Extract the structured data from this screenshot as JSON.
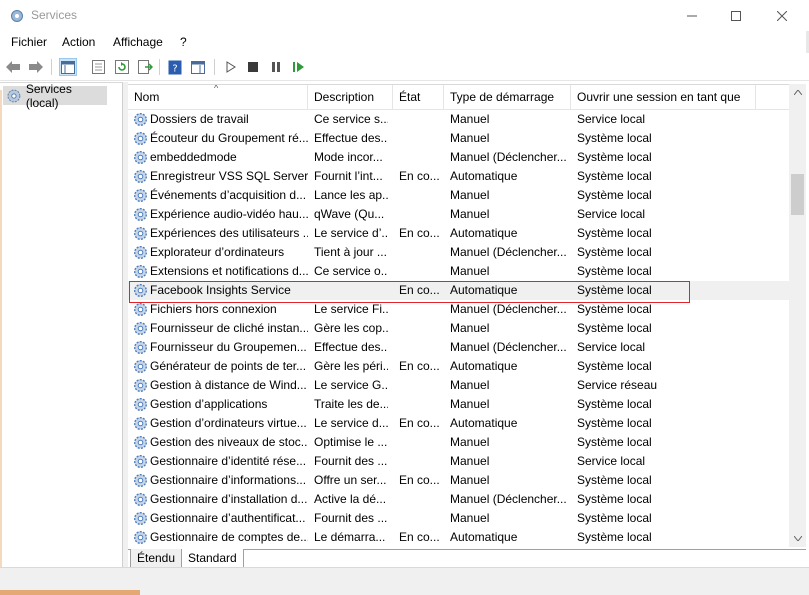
{
  "window": {
    "title": "Services"
  },
  "menu": [
    "Fichier",
    "Action",
    "Affichage",
    "?"
  ],
  "tree": {
    "root_label": "Services (local)"
  },
  "columns": [
    "Nom",
    "Description",
    "État",
    "Type de démarrage",
    "Ouvrir une session en tant que"
  ],
  "rows": [
    {
      "name": "Dossiers de travail",
      "desc": "Ce service s...",
      "state": "",
      "startup": "Manuel",
      "logon": "Service local"
    },
    {
      "name": "Écouteur du Groupement ré...",
      "desc": "Effectue des...",
      "state": "",
      "startup": "Manuel",
      "logon": "Système local"
    },
    {
      "name": "embeddedmode",
      "desc": "Mode incor...",
      "state": "",
      "startup": "Manuel (Déclencher...",
      "logon": "Système local"
    },
    {
      "name": "Enregistreur VSS SQL Server",
      "desc": "Fournit l’int...",
      "state": "En co...",
      "startup": "Automatique",
      "logon": "Système local"
    },
    {
      "name": "Événements d’acquisition d...",
      "desc": "Lance les ap...",
      "state": "",
      "startup": "Manuel",
      "logon": "Système local"
    },
    {
      "name": "Expérience audio-vidéo hau...",
      "desc": "qWave (Qu...",
      "state": "",
      "startup": "Manuel",
      "logon": "Service local"
    },
    {
      "name": "Expériences des utilisateurs ...",
      "desc": "Le service d’...",
      "state": "En co...",
      "startup": "Automatique",
      "logon": "Système local"
    },
    {
      "name": "Explorateur d’ordinateurs",
      "desc": "Tient à jour ...",
      "state": "",
      "startup": "Manuel (Déclencher...",
      "logon": "Système local"
    },
    {
      "name": "Extensions et notifications d...",
      "desc": "Ce service o...",
      "state": "",
      "startup": "Manuel",
      "logon": "Système local"
    },
    {
      "name": "Facebook Insights Service",
      "desc": "",
      "state": "En co...",
      "startup": "Automatique",
      "logon": "Système local"
    },
    {
      "name": "Fichiers hors connexion",
      "desc": "Le service Fi...",
      "state": "",
      "startup": "Manuel (Déclencher...",
      "logon": "Système local"
    },
    {
      "name": "Fournisseur de cliché instan...",
      "desc": "Gère les cop...",
      "state": "",
      "startup": "Manuel",
      "logon": "Système local"
    },
    {
      "name": "Fournisseur du Groupemen...",
      "desc": "Effectue des...",
      "state": "",
      "startup": "Manuel (Déclencher...",
      "logon": "Service local"
    },
    {
      "name": "Générateur de points de ter...",
      "desc": "Gère les péri...",
      "state": "En co...",
      "startup": "Automatique",
      "logon": "Système local"
    },
    {
      "name": "Gestion à distance de Wind...",
      "desc": "Le service G...",
      "state": "",
      "startup": "Manuel",
      "logon": "Service réseau"
    },
    {
      "name": "Gestion d’applications",
      "desc": "Traite les de...",
      "state": "",
      "startup": "Manuel",
      "logon": "Système local"
    },
    {
      "name": "Gestion d’ordinateurs virtue...",
      "desc": "Le service d...",
      "state": "En co...",
      "startup": "Automatique",
      "logon": "Système local"
    },
    {
      "name": "Gestion des niveaux de stoc...",
      "desc": "Optimise le ...",
      "state": "",
      "startup": "Manuel",
      "logon": "Système local"
    },
    {
      "name": "Gestionnaire d’identité rése...",
      "desc": "Fournit des ...",
      "state": "",
      "startup": "Manuel",
      "logon": "Service local"
    },
    {
      "name": "Gestionnaire d’informations...",
      "desc": "Offre un ser...",
      "state": "En co...",
      "startup": "Manuel",
      "logon": "Système local"
    },
    {
      "name": "Gestionnaire d’installation d...",
      "desc": "Active la dé...",
      "state": "",
      "startup": "Manuel (Déclencher...",
      "logon": "Système local"
    },
    {
      "name": "Gestionnaire d’authentificat...",
      "desc": "Fournit des ...",
      "state": "",
      "startup": "Manuel",
      "logon": "Système local"
    },
    {
      "name": "Gestionnaire de comptes de...",
      "desc": "Le démarra...",
      "state": "En co...",
      "startup": "Automatique",
      "logon": "Système local"
    }
  ],
  "selected_row": 9,
  "tabs": [
    "Étendu",
    "Standard"
  ],
  "active_tab": "Standard",
  "colors": {
    "selection_border": "#e0242a",
    "gear_blue": "#4a7cc0"
  }
}
